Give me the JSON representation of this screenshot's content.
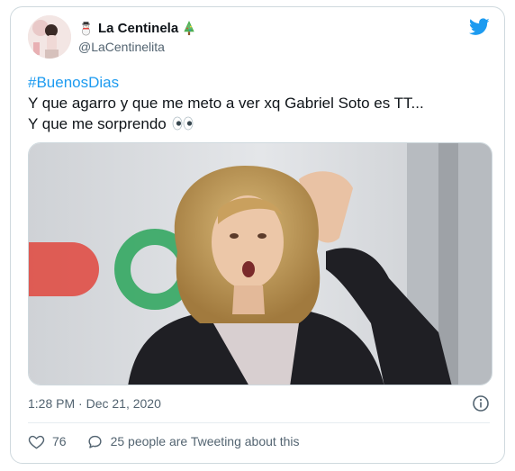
{
  "tweet": {
    "author": {
      "name": "La Centinela",
      "handle": "@LaCentinelita",
      "icons": [
        "snowman-emoji",
        "christmas-tree-emoji"
      ]
    },
    "text": {
      "hashtag": "#BuenosDias",
      "line1": "Y que agarro y que me meto a ver xq Gabriel Soto es TT...",
      "line2": "Y que me sorprendo",
      "emoji": "eyes-emoji"
    },
    "media": {
      "kind": "photo",
      "description_icon": "surprised-woman-photo"
    },
    "timestamp": "1:28 PM · Dec 21, 2020",
    "likes": "76",
    "conversation": "25 people are Tweeting about this"
  },
  "colors": {
    "brand": "#1d9bf0",
    "text": "#0f1419",
    "muted": "#536471",
    "border": "#cfd9de"
  }
}
